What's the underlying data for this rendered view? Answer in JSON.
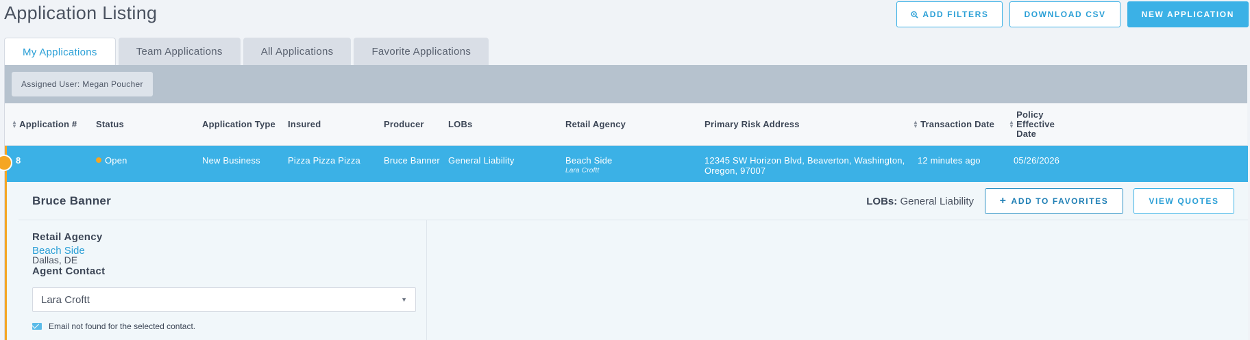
{
  "page": {
    "title": "Application Listing"
  },
  "actions": {
    "add_filters": "ADD FILTERS",
    "download_csv": "DOWNLOAD CSV",
    "new_application": "NEW APPLICATION"
  },
  "tabs": [
    {
      "label": "My Applications",
      "active": true
    },
    {
      "label": "Team Applications",
      "active": false
    },
    {
      "label": "All Applications",
      "active": false
    },
    {
      "label": "Favorite Applications",
      "active": false
    }
  ],
  "filter": {
    "chip": "Assigned User: Megan Poucher"
  },
  "table": {
    "columns": {
      "app_num": "Application #",
      "status": "Status",
      "app_type": "Application Type",
      "insured": "Insured",
      "producer": "Producer",
      "lobs": "LOBs",
      "retail_agency": "Retail Agency",
      "risk_address": "Primary Risk Address",
      "transaction_date": "Transaction Date",
      "policy_effective_1": "Policy",
      "policy_effective_2": "Effective",
      "policy_effective_3": "Date"
    },
    "rows": [
      {
        "app_num": "8",
        "status": "Open",
        "app_type": "New Business",
        "insured": "Pizza Pizza Pizza",
        "producer": "Bruce Banner",
        "lobs": "General Liability",
        "retail_agency": "Beach Side",
        "retail_agent": "Lara Croftt",
        "risk_address_1": "12345 SW Horizon Blvd, Beaverton, Washington,",
        "risk_address_2": "Oregon, 97007",
        "transaction_date": "12 minutes ago",
        "policy_effective": "05/26/2026"
      }
    ]
  },
  "detail": {
    "name": "Bruce Banner",
    "lobs_label": "LOBs:",
    "lobs_value": "General Liability",
    "add_favorites": "ADD TO FAVORITES",
    "view_quotes": "VIEW QUOTES",
    "retail_agency_label": "Retail Agency",
    "retail_agency_name": "Beach Side",
    "retail_agency_location": "Dallas, DE",
    "agent_contact_label": "Agent Contact",
    "agent_contact_value": "Lara Croftt",
    "email_note": "Email not found for the selected contact."
  },
  "colors": {
    "accent": "#3bb1e6",
    "status_open": "#f5a623",
    "filter_bar": "#b6c2ce"
  }
}
